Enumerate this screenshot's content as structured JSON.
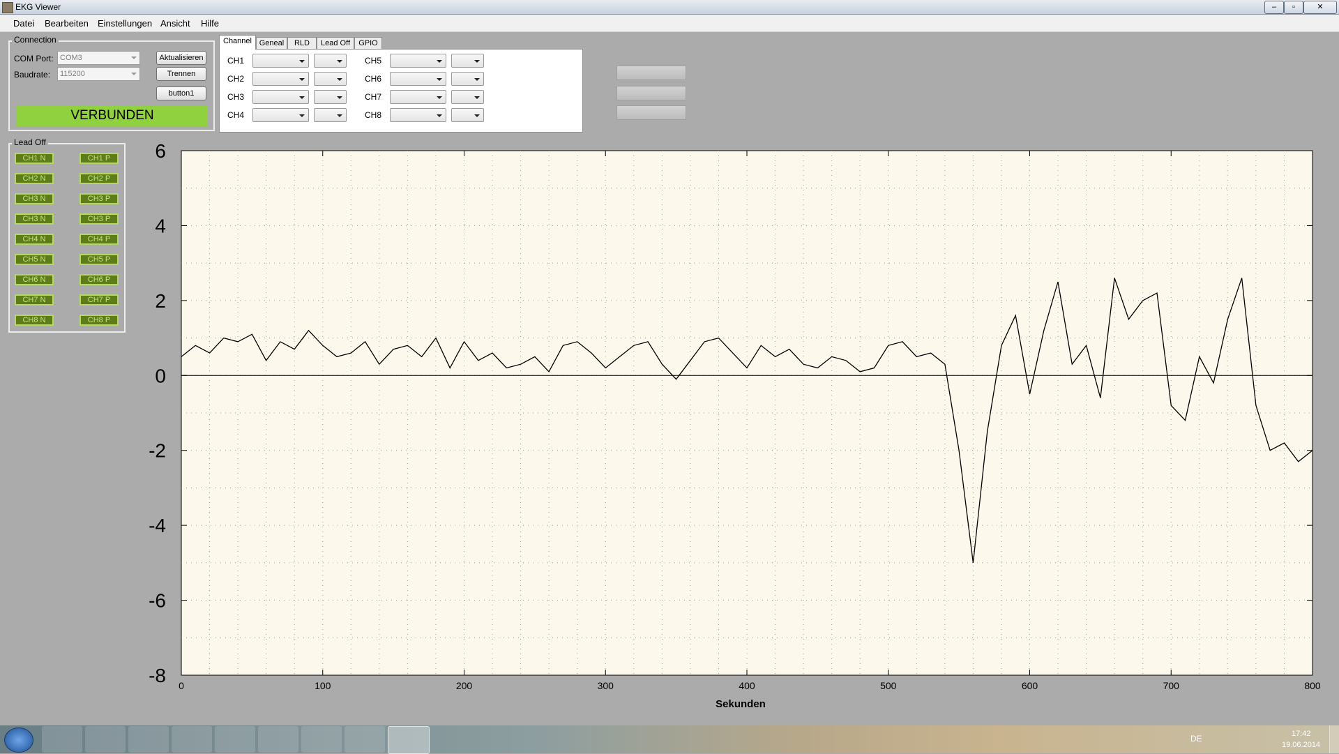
{
  "window": {
    "title": "EKG Viewer"
  },
  "menu": [
    "Datei",
    "Bearbeiten",
    "Einstellungen",
    "Ansicht",
    "Hilfe"
  ],
  "connection": {
    "title": "Connection",
    "com_port_label": "COM Port:",
    "com_port_value": "COM3",
    "baudrate_label": "Baudrate:",
    "baudrate_value": "115200",
    "refresh_button": "Aktualisieren",
    "disconnect_button": "Trennen",
    "button1": "button1",
    "status": "VERBUNDEN",
    "status_color": "#8fd13e"
  },
  "lead_off": {
    "title": "Lead Off",
    "n_buttons": [
      "CH1 N",
      "CH2 N",
      "CH3 N",
      "CH3 N",
      "CH4 N",
      "CH5 N",
      "CH6 N",
      "CH7 N",
      "CH8 N"
    ],
    "p_buttons": [
      "CH1 P",
      "CH2 P",
      "CH3 P",
      "CH3 P",
      "CH4 P",
      "CH5 P",
      "CH6 P",
      "CH7 P",
      "CH8 P"
    ]
  },
  "tabs": [
    "Channel",
    "Geneal",
    "RLD",
    "Lead Off",
    "GPIO"
  ],
  "active_tab": "Channel",
  "channels_left": [
    "CH1",
    "CH2",
    "CH3",
    "CH4"
  ],
  "channels_right": [
    "CH5",
    "CH6",
    "CH7",
    "CH8"
  ],
  "chart_data": {
    "type": "line",
    "title": "",
    "xlabel": "Sekunden",
    "ylabel": "",
    "xlim": [
      0,
      800
    ],
    "ylim": [
      -8,
      6
    ],
    "x_ticks": [
      "0",
      "100",
      "200",
      "300",
      "400",
      "500",
      "600",
      "700",
      "800"
    ],
    "y_ticks": [
      "6",
      "4",
      "2",
      "0",
      "-2",
      "-4",
      "-6",
      "-8"
    ],
    "grid": true,
    "background": "#fcf8eb",
    "line_color": "#000000",
    "x": [
      0,
      10,
      20,
      30,
      40,
      50,
      60,
      70,
      80,
      90,
      100,
      110,
      120,
      130,
      140,
      150,
      160,
      170,
      180,
      190,
      200,
      210,
      220,
      230,
      240,
      250,
      260,
      270,
      280,
      290,
      300,
      310,
      320,
      330,
      340,
      350,
      360,
      370,
      380,
      390,
      400,
      410,
      420,
      430,
      440,
      450,
      460,
      470,
      480,
      490,
      500,
      510,
      520,
      530,
      540,
      550,
      560,
      570,
      580,
      590,
      600,
      610,
      620,
      630,
      640,
      650,
      660,
      670,
      680,
      690,
      700,
      710,
      720,
      730,
      740,
      750,
      760,
      770,
      780,
      790,
      800
    ],
    "y": [
      0.5,
      0.8,
      0.6,
      1.0,
      0.9,
      1.1,
      0.4,
      0.9,
      0.7,
      1.2,
      0.8,
      0.5,
      0.6,
      0.9,
      0.3,
      0.7,
      0.8,
      0.5,
      1.0,
      0.2,
      0.9,
      0.4,
      0.6,
      0.2,
      0.3,
      0.5,
      0.1,
      0.8,
      0.9,
      0.6,
      0.2,
      0.5,
      0.8,
      0.9,
      0.3,
      -0.1,
      0.4,
      0.9,
      1.0,
      0.6,
      0.2,
      0.8,
      0.5,
      0.7,
      0.3,
      0.2,
      0.5,
      0.4,
      0.1,
      0.2,
      0.8,
      0.9,
      0.5,
      0.6,
      0.3,
      -2.0,
      -5.0,
      -1.5,
      0.8,
      1.6,
      -0.5,
      1.2,
      2.5,
      0.3,
      0.8,
      -0.6,
      2.6,
      1.5,
      2.0,
      2.2,
      -0.8,
      -1.2,
      0.5,
      -0.2,
      1.5,
      2.6,
      -0.8,
      -2.0,
      -1.8,
      -2.3,
      -2.0
    ]
  },
  "taskbar": {
    "language": "DE",
    "time": "17:42",
    "date": "19.06.2014"
  }
}
